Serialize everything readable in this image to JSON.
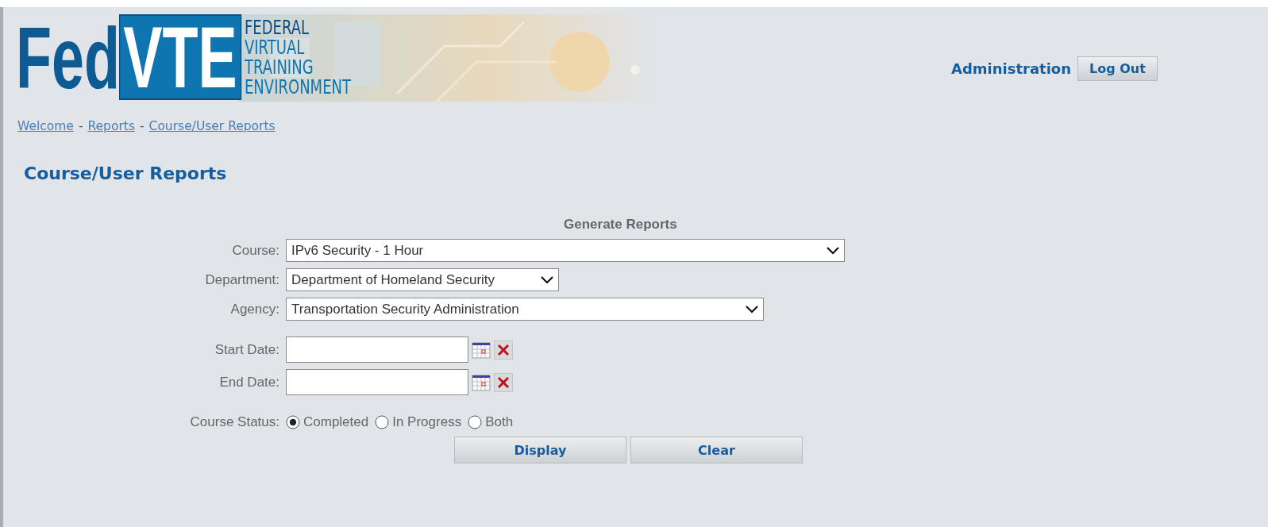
{
  "logo": {
    "prefix": "Fed",
    "boxed": "VTE",
    "lines": [
      "FEDERAL",
      "VIRTUAL",
      "TRAINING",
      "ENVIRONMENT"
    ]
  },
  "user_menu": {
    "label": "Administration",
    "button": "Log Out"
  },
  "breadcrumbs": [
    "Welcome",
    "Reports",
    "Course/User Reports"
  ],
  "breadcrumb_separator": "-",
  "page_title": "Course/User Reports",
  "form": {
    "heading": "Generate Reports",
    "selects": [
      {
        "label": "Course:",
        "value": "IPv6 Security - 1 Hour"
      },
      {
        "label": "Department:",
        "value": "Department of Homeland Security"
      },
      {
        "label": "Agency:",
        "value": "Transportation Security Administration"
      }
    ],
    "dates": [
      {
        "label": "Start Date:"
      },
      {
        "label": "End Date:"
      }
    ],
    "status": {
      "label": "Course Status:",
      "options": [
        {
          "label": "Completed",
          "selected": true
        },
        {
          "label": "In Progress",
          "selected": false
        },
        {
          "label": "Both",
          "selected": false
        }
      ]
    },
    "buttons": [
      "Display",
      "Clear"
    ]
  }
}
